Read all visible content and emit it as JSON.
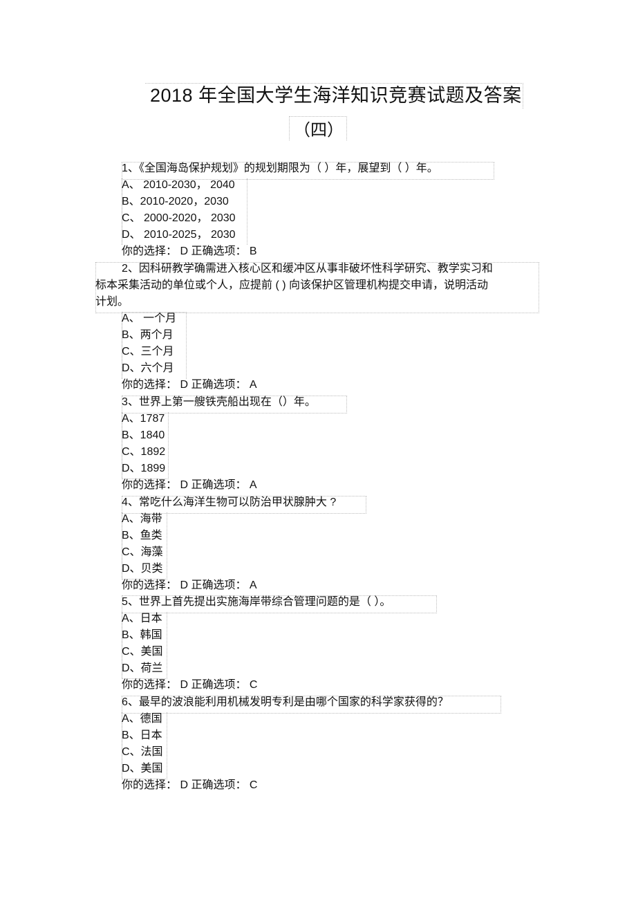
{
  "document": {
    "title": "2018 年全国大学生海洋知识竞赛试题及答案",
    "subtitle": "（四）"
  },
  "questions": [
    {
      "stem": "1、《全国海岛保护规划》的规划期限为（    ）年，展望到（    ）年。",
      "options": [
        "A、 2010-2030， 2040",
        "B、2010-2020，2030",
        "C、 2000-2020， 2030",
        "D、 2010-2025， 2030"
      ],
      "answer_line": "你的选择： D 正确选项： B"
    },
    {
      "stem_lines": [
        "2、因科研教学确需进入核心区和缓冲区从事非破坏性科学研究、教学实习和",
        "标本采集活动的单位或个人，应提前 ( ) 向该保护区管理机构提交申请，说明活动",
        "计划。"
      ],
      "options": [
        "A、 一个月",
        "B、两个月",
        "C、三个月",
        "D、六个月"
      ],
      "answer_line": "你的选择： D 正确选项： A"
    },
    {
      "stem": "3、世界上第一艘铁壳船出现在（）年。",
      "options": [
        "A、1787",
        "B、1840",
        "C、1892",
        "D、1899"
      ],
      "answer_line": "你的选择： D 正确选项： A"
    },
    {
      "stem": "4、常吃什么海洋生物可以防治甲状腺肿大    ?",
      "options": [
        "A、海带",
        "B、鱼类",
        "C、海藻",
        "D、贝类"
      ],
      "answer_line": "你的选择： D 正确选项： A"
    },
    {
      "stem": "5、世界上首先提出实施海岸带综合管理问题的是（       ）。",
      "options": [
        "A、日本",
        "B、韩国",
        "C、美国",
        "D、荷兰"
      ],
      "answer_line": "你的选择： D 正确选项： C"
    },
    {
      "stem": "6、最早的波浪能利用机械发明专利是由哪个国家的科学家获得的？",
      "options": [
        "A、德国",
        "B、日本",
        "C、法国",
        "D、美国"
      ],
      "answer_line": "你的选择： D 正确选项： C"
    }
  ]
}
